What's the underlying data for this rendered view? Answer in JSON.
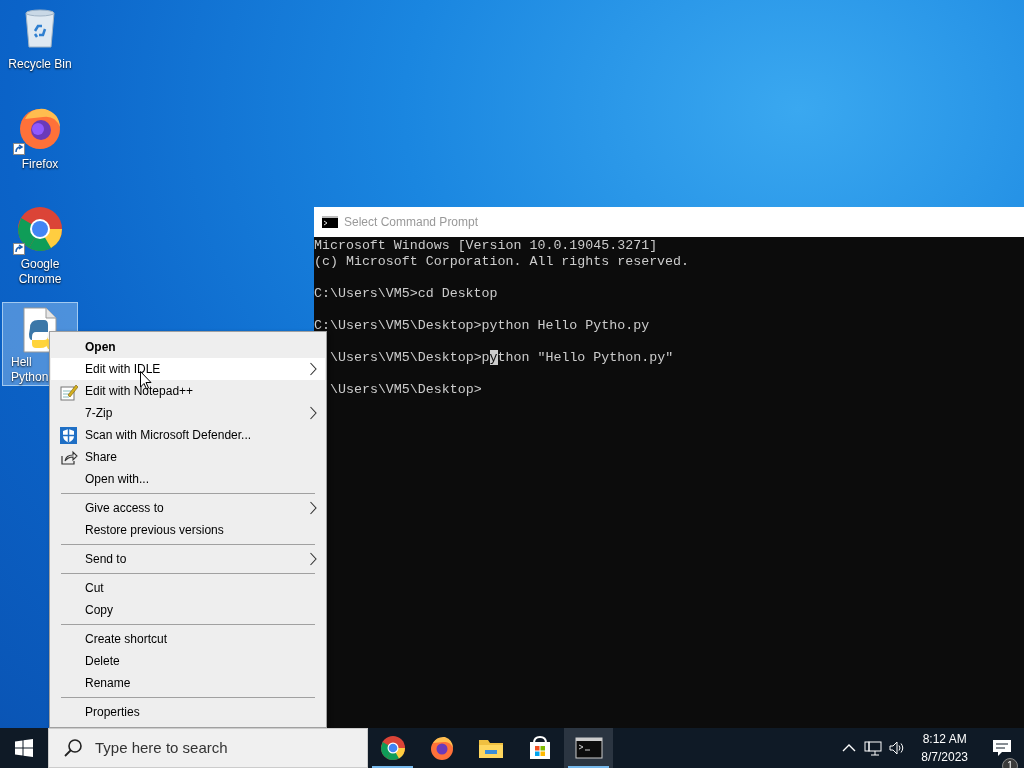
{
  "desktop_icons": [
    {
      "label": [
        "Recycle Bin"
      ],
      "kind": "recycle",
      "shortcut": false,
      "selected": false,
      "clipped": false
    },
    {
      "label": [
        "Firefox"
      ],
      "kind": "firefox",
      "shortcut": true,
      "selected": false,
      "clipped": false
    },
    {
      "label": [
        "Google",
        "Chrome"
      ],
      "kind": "chrome",
      "shortcut": true,
      "selected": false,
      "clipped": false
    },
    {
      "label": [
        "Hell",
        "Python"
      ],
      "kind": "python",
      "shortcut": false,
      "selected": true,
      "clipped": true
    }
  ],
  "console_window": {
    "title": "Select Command Prompt",
    "active": false,
    "blocks": [
      [
        {
          "text": "Microsoft Windows [Version 10.0.19045.3271]",
          "clipped": false
        },
        {
          "text": "(c) Microsoft Corporation. All rights reserved.",
          "clipped": false
        }
      ],
      [
        {
          "text": "C:\\Users\\VM5>cd Desktop",
          "clipped": false
        }
      ],
      [
        {
          "text": "C:\\Users\\VM5\\Desktop>python Hello Pytho.py",
          "clipped": false
        }
      ],
      [
        {
          "text": "\\Users\\VM5\\Desktop>p",
          "cursor": "y",
          "after": "thon \"Hello Python.py\"",
          "clipped": true
        }
      ],
      [
        {
          "text": "\\Users\\VM5\\Desktop>",
          "clipped": true
        }
      ]
    ]
  },
  "context_menu": [
    {
      "kind": "item",
      "label": "Open",
      "default": true,
      "submenu": false,
      "selected": false
    },
    {
      "kind": "item",
      "label": "Edit with IDLE",
      "default": false,
      "submenu": true,
      "selected": true
    },
    {
      "kind": "notepad",
      "label": "Edit with Notepad++",
      "default": false,
      "submenu": false,
      "selected": false
    },
    {
      "kind": "item",
      "label": "7-Zip",
      "default": false,
      "submenu": true,
      "selected": false
    },
    {
      "kind": "shield",
      "label": "Scan with Microsoft Defender...",
      "default": false,
      "submenu": false,
      "selected": false
    },
    {
      "kind": "share",
      "label": "Share",
      "default": false,
      "submenu": false,
      "selected": false
    },
    {
      "kind": "item",
      "label": "Open with...",
      "default": false,
      "submenu": false,
      "selected": false
    },
    {
      "kind": "separator"
    },
    {
      "kind": "item",
      "label": "Give access to",
      "default": false,
      "submenu": true,
      "selected": false
    },
    {
      "kind": "item",
      "label": "Restore previous versions",
      "default": false,
      "submenu": false,
      "selected": false
    },
    {
      "kind": "separator"
    },
    {
      "kind": "item",
      "label": "Send to",
      "default": false,
      "submenu": true,
      "selected": false
    },
    {
      "kind": "separator"
    },
    {
      "kind": "item",
      "label": "Cut",
      "default": false,
      "submenu": false,
      "selected": false
    },
    {
      "kind": "item",
      "label": "Copy",
      "default": false,
      "submenu": false,
      "selected": false
    },
    {
      "kind": "separator"
    },
    {
      "kind": "item",
      "label": "Create shortcut",
      "default": false,
      "submenu": false,
      "selected": false
    },
    {
      "kind": "item",
      "label": "Delete",
      "default": false,
      "submenu": false,
      "selected": false
    },
    {
      "kind": "item",
      "label": "Rename",
      "default": false,
      "submenu": false,
      "selected": false
    },
    {
      "kind": "separator"
    },
    {
      "kind": "item",
      "label": "Properties",
      "default": false,
      "submenu": false,
      "selected": false
    }
  ],
  "taskbar": {
    "search": {
      "placeholder": "Type here to search"
    },
    "apps": [
      {
        "kind": "chrome",
        "running": true,
        "selected": false
      },
      {
        "kind": "firefox",
        "running": false,
        "selected": false
      },
      {
        "kind": "folder",
        "running": false,
        "selected": false
      },
      {
        "kind": "store",
        "running": false,
        "selected": false
      },
      {
        "kind": "console",
        "running": true,
        "selected": true
      }
    ],
    "clock": {
      "time": "8:12 AM",
      "date": "8/7/2023"
    },
    "notifications": {
      "count": "1"
    }
  }
}
